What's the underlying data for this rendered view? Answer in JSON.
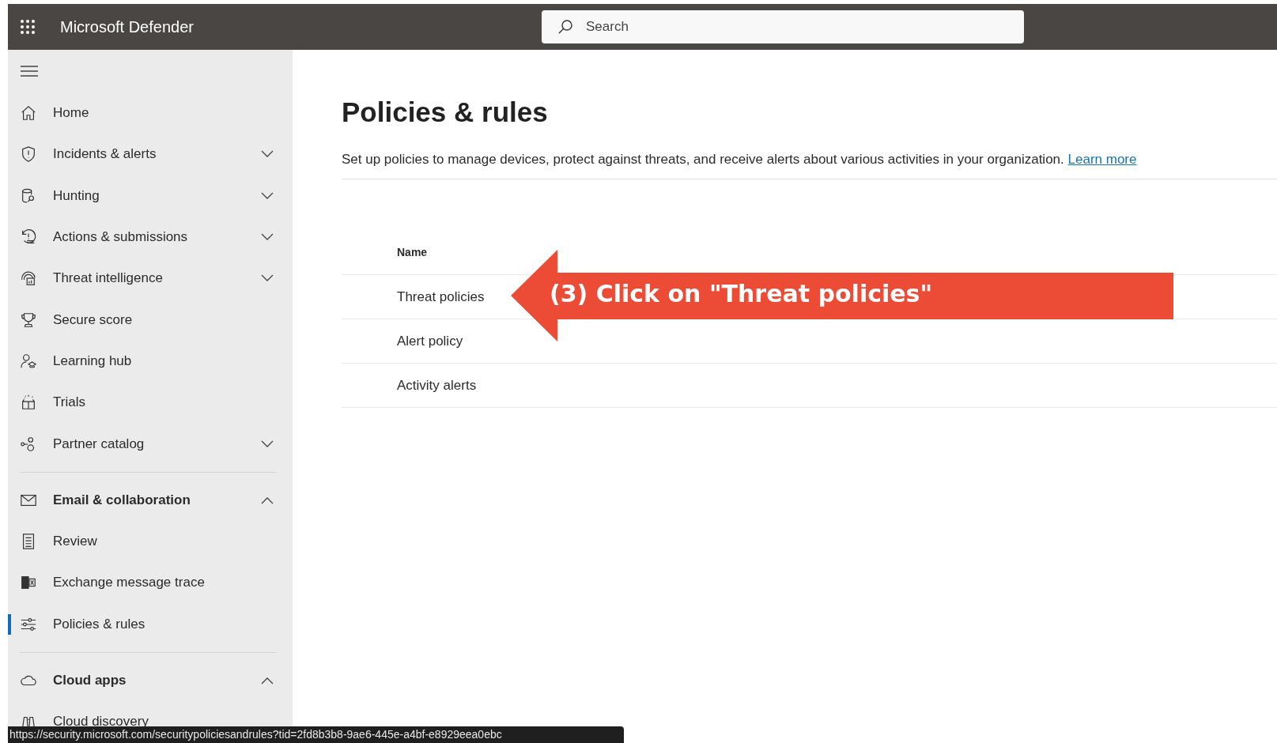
{
  "top_bar": {
    "title": "Microsoft Defender",
    "search": {
      "placeholder": "Search"
    }
  },
  "sidebar": {
    "sections": [
      {
        "items": [
          {
            "kind": "link",
            "label": "Home",
            "selected": false
          },
          {
            "kind": "link",
            "label": "Incidents & alerts",
            "selected": false,
            "expanded": false
          },
          {
            "kind": "link",
            "label": "Hunting",
            "selected": false,
            "expanded": false
          },
          {
            "kind": "link",
            "label": "Actions & submissions",
            "selected": false,
            "expanded": false
          },
          {
            "kind": "link",
            "label": "Threat intelligence",
            "selected": false,
            "expanded": false
          },
          {
            "kind": "link",
            "label": "Secure score",
            "selected": false
          },
          {
            "kind": "link",
            "label": "Learning hub",
            "selected": false
          },
          {
            "kind": "link",
            "label": "Trials",
            "selected": false
          },
          {
            "kind": "link",
            "label": "Partner catalog",
            "selected": false,
            "expanded": false
          }
        ]
      },
      {
        "items": [
          {
            "kind": "group",
            "label": "Email & collaboration",
            "selected": false,
            "expanded": true
          },
          {
            "kind": "link",
            "label": "Review",
            "selected": false
          },
          {
            "kind": "link",
            "label": "Exchange message trace",
            "selected": false
          },
          {
            "kind": "link",
            "label": "Policies & rules",
            "selected": true
          }
        ]
      },
      {
        "items": [
          {
            "kind": "group",
            "label": "Cloud apps",
            "selected": false,
            "expanded": true
          },
          {
            "kind": "link",
            "label": "Cloud discovery",
            "selected": false
          }
        ]
      }
    ]
  },
  "page": {
    "title": "Policies & rules",
    "description": "Set up policies to manage devices, protect against threats, and receive alerts about various activities in your organization.",
    "link": "Learn more",
    "table": {
      "columns": [
        "Name"
      ],
      "rows": [
        "Threat policies",
        "Alert policy",
        "Activity alerts"
      ]
    }
  },
  "callout": {
    "text": "(3) Click on \"Threat policies\""
  },
  "status_bar": {
    "url": "https://security.microsoft.com/securitypoliciesandrules?tid=2fd8b3b8-9ae6-445e-a4bf-e8929eea0ebc"
  }
}
